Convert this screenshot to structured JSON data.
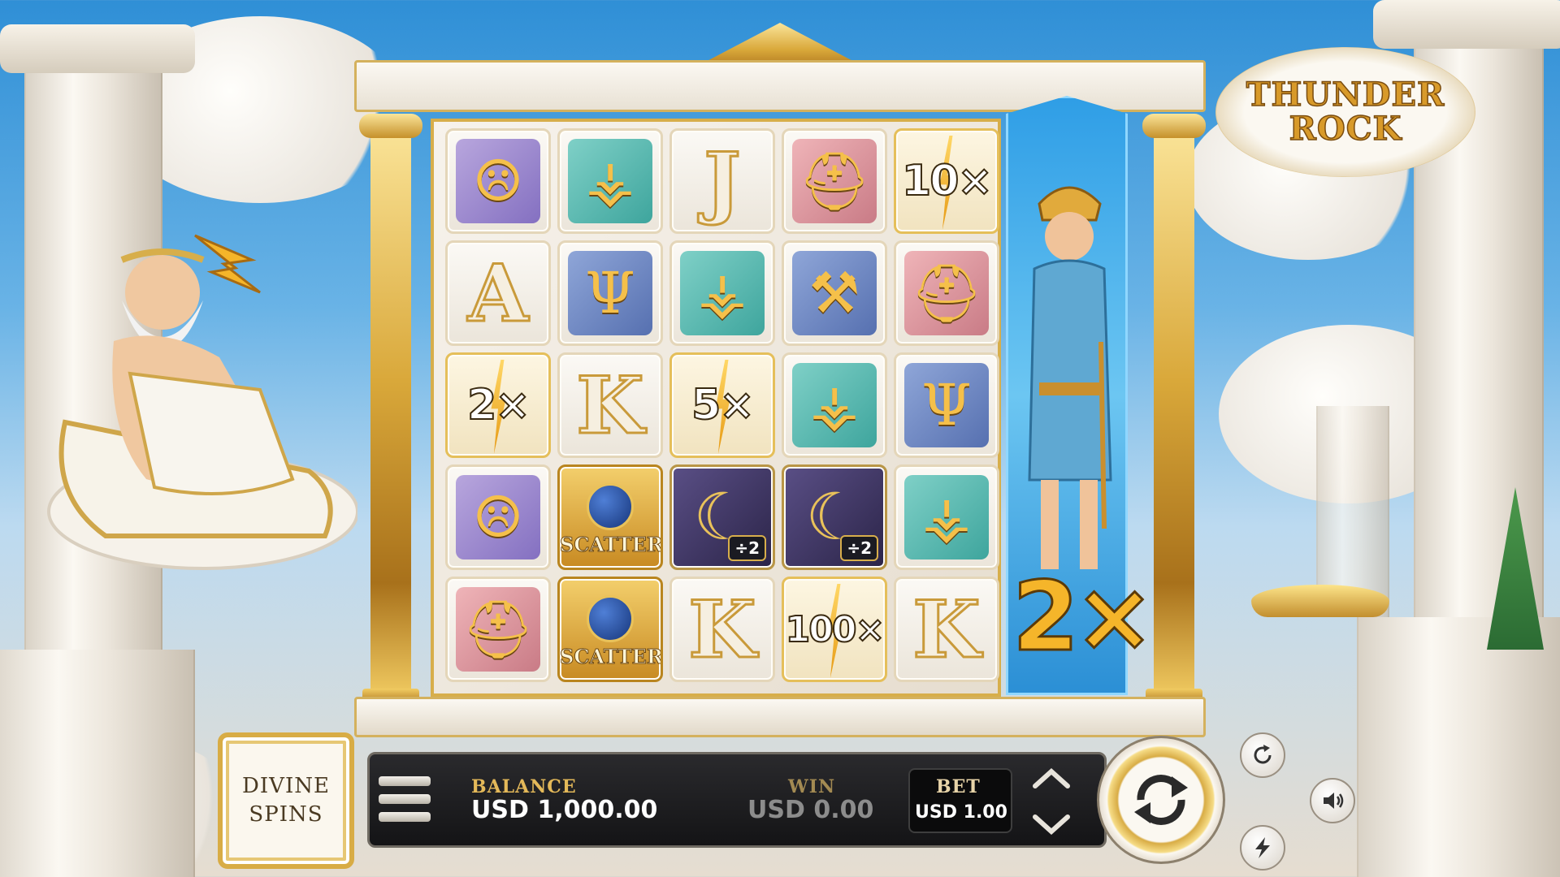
{
  "game": {
    "logo": {
      "line1": "THUNDER",
      "line2": "ROCK"
    }
  },
  "reels": {
    "grid": [
      [
        {
          "kind": "symbol",
          "icon": "gorgon-shield-icon",
          "tone": "purple"
        },
        {
          "kind": "symbol",
          "icon": "winged-sandals-icon",
          "tone": "teal"
        },
        {
          "kind": "letter",
          "text": "J"
        },
        {
          "kind": "symbol",
          "icon": "spartan-helmet-icon",
          "tone": "rose"
        },
        {
          "kind": "multiplier",
          "text": "10×"
        }
      ],
      [
        {
          "kind": "letter",
          "text": "A"
        },
        {
          "kind": "symbol",
          "icon": "trident-icon",
          "tone": "blue"
        },
        {
          "kind": "symbol",
          "icon": "winged-sandals-icon",
          "tone": "teal"
        },
        {
          "kind": "symbol",
          "icon": "hammer-icon",
          "tone": "blue"
        },
        {
          "kind": "symbol",
          "icon": "spartan-helmet-icon",
          "tone": "rose"
        }
      ],
      [
        {
          "kind": "multiplier",
          "text": "2×"
        },
        {
          "kind": "letter",
          "text": "K"
        },
        {
          "kind": "multiplier",
          "text": "5×"
        },
        {
          "kind": "symbol",
          "icon": "winged-sandals-icon",
          "tone": "teal"
        },
        {
          "kind": "symbol",
          "icon": "trident-icon",
          "tone": "blue"
        }
      ],
      [
        {
          "kind": "symbol",
          "icon": "gorgon-shield-icon",
          "tone": "purple"
        },
        {
          "kind": "scatter",
          "text": "SCATTER"
        },
        {
          "kind": "divider",
          "icon": "scythe-icon",
          "text": "÷2"
        },
        {
          "kind": "divider",
          "icon": "scythe-icon",
          "text": "÷2"
        },
        {
          "kind": "symbol",
          "icon": "winged-sandals-icon",
          "tone": "teal"
        }
      ],
      [
        {
          "kind": "symbol",
          "icon": "spartan-helmet-icon",
          "tone": "rose"
        },
        {
          "kind": "scatter",
          "text": "SCATTER"
        },
        {
          "kind": "letter",
          "text": "K"
        },
        {
          "kind": "multiplier",
          "text": "100×"
        },
        {
          "kind": "letter",
          "text": "K"
        }
      ]
    ],
    "feature_reel": {
      "character": "hermes",
      "multiplier": "2×"
    }
  },
  "controls": {
    "divine_spins": {
      "line1": "DIVINE",
      "line2": "SPINS"
    },
    "balance": {
      "label": "BALANCE",
      "value": "USD 1,000.00"
    },
    "win": {
      "label": "WIN",
      "value": "USD 0.00"
    },
    "bet": {
      "label": "BET",
      "value": "USD 1.00"
    },
    "icons": {
      "menu": "menu-icon",
      "bet_up": "chevron-up-icon",
      "bet_down": "chevron-down-icon",
      "spin": "spin-icon",
      "autoplay": "autoplay-icon",
      "sound": "speaker-icon",
      "turbo": "lightning-icon"
    }
  },
  "colors": {
    "gold": "#d8ac45",
    "label_gold": "#e4b959",
    "bar_dark": "#141416",
    "feature_blue": "#2f9ee6"
  }
}
